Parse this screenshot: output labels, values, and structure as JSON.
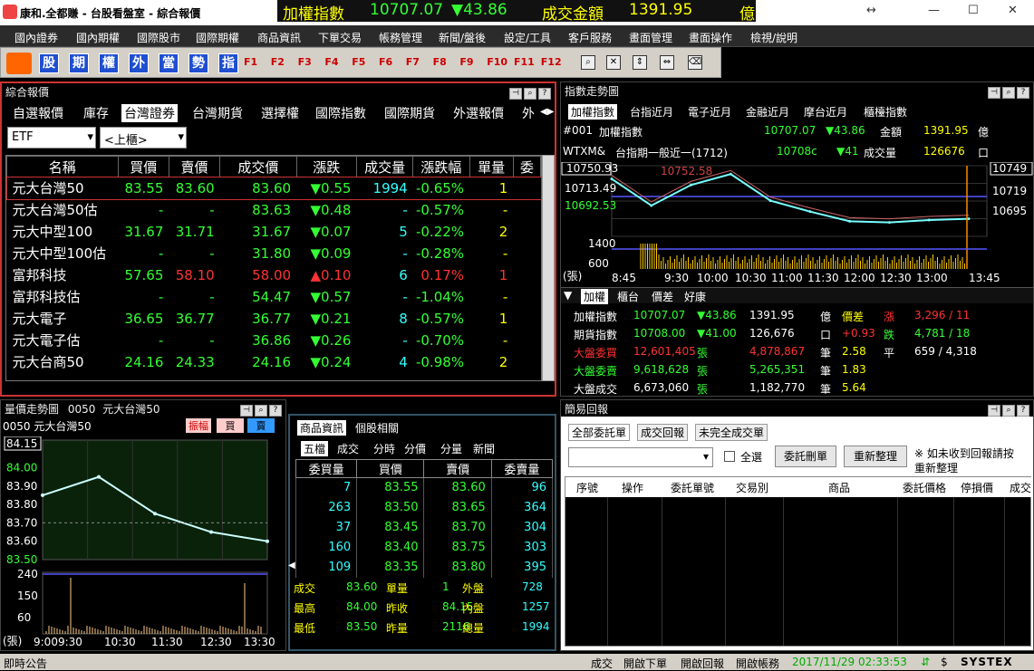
{
  "window": {
    "title": "康和.全都賺 - 台股看盤室 - 綜合報價"
  },
  "ticker": {
    "label": "加權指數",
    "value": "10707.07",
    "change": "▼43.86",
    "amt_label": "成交金額",
    "amt": "1391.95",
    "unit": "億"
  },
  "menu": [
    "國內證券",
    "國內期權",
    "國際股市",
    "國際期權",
    "商品資訊",
    "下單交易",
    "帳務管理",
    "新聞/盤後",
    "設定/工具",
    "客戶服務",
    "畫面管理",
    "畫面操作",
    "檢視/說明"
  ],
  "toolbar": {
    "buttons": [
      "股",
      "期",
      "權",
      "外",
      "當",
      "勢",
      "指"
    ],
    "fkeys": [
      "F1",
      "F2",
      "F3",
      "F4",
      "F5",
      "F6",
      "F7",
      "F8",
      "F9",
      "F10",
      "F11",
      "F12"
    ]
  },
  "quote_panel": {
    "title": "綜合報價",
    "tabs": [
      "自選報價",
      "庫存",
      "台灣證券",
      "台灣期貨",
      "選擇權",
      "國際指數",
      "國際期貨",
      "外選報價",
      "外"
    ],
    "selected_tab": "台灣證券",
    "filter1": "ETF",
    "filter2": "<上櫃>",
    "headers": [
      "名稱",
      "買價",
      "賣價",
      "成交價",
      "漲跌",
      "成交量",
      "漲跌幅",
      "單量",
      "委"
    ],
    "rows": [
      {
        "name": "元大台灣50",
        "bid": "83.55",
        "ask": "83.60",
        "last": "83.60",
        "chg": "▼0.55",
        "vol": "1994",
        "pct": "-0.65%",
        "unit": "1",
        "dir": "down"
      },
      {
        "name": "元大台灣50估",
        "bid": "-",
        "ask": "-",
        "last": "83.63",
        "chg": "▼0.48",
        "vol": "-",
        "pct": "-0.57%",
        "unit": "-",
        "dir": "down"
      },
      {
        "name": "元大中型100",
        "bid": "31.67",
        "ask": "31.71",
        "last": "31.67",
        "chg": "▼0.07",
        "vol": "5",
        "pct": "-0.22%",
        "unit": "2",
        "dir": "down"
      },
      {
        "name": "元大中型100估",
        "bid": "-",
        "ask": "-",
        "last": "31.80",
        "chg": "▼0.09",
        "vol": "-",
        "pct": "-0.28%",
        "unit": "-",
        "dir": "down"
      },
      {
        "name": "富邦科技",
        "bid": "57.65",
        "ask": "58.10",
        "last": "58.00",
        "chg": "▲0.10",
        "vol": "6",
        "pct": "0.17%",
        "unit": "1",
        "dir": "up"
      },
      {
        "name": "富邦科技估",
        "bid": "-",
        "ask": "-",
        "last": "54.47",
        "chg": "▼0.57",
        "vol": "-",
        "pct": "-1.04%",
        "unit": "-",
        "dir": "down"
      },
      {
        "name": "元大電子",
        "bid": "36.65",
        "ask": "36.77",
        "last": "36.77",
        "chg": "▼0.21",
        "vol": "8",
        "pct": "-0.57%",
        "unit": "1",
        "dir": "down"
      },
      {
        "name": "元大電子估",
        "bid": "-",
        "ask": "-",
        "last": "36.86",
        "chg": "▼0.26",
        "vol": "-",
        "pct": "-0.70%",
        "unit": "-",
        "dir": "down"
      },
      {
        "name": "元大台商50",
        "bid": "24.16",
        "ask": "24.33",
        "last": "24.16",
        "chg": "▼0.24",
        "vol": "4",
        "pct": "-0.98%",
        "unit": "2",
        "dir": "down"
      }
    ]
  },
  "index_panel": {
    "title": "指數走勢圖",
    "tabs": [
      "加權指數",
      "台指近月",
      "電子近月",
      "金融近月",
      "摩台近月",
      "櫃檯指數"
    ],
    "line1": {
      "code": "#001",
      "name": "加權指數",
      "value": "10707.07",
      "chg": "▼43.86",
      "amt_label": "金額",
      "amt": "1391.95",
      "unit": "億"
    },
    "line2": {
      "code": "WTXM&",
      "name": "台指期一般近一(1712)",
      "value": "10708c",
      "chg": "▼41",
      "vol_label": "成交量",
      "vol": "126676",
      "unit": "口"
    },
    "y_labels": [
      "10750.93",
      "10713.49",
      "10692.53"
    ],
    "y_right": [
      "10749",
      "10719",
      "10695"
    ],
    "vol_labels": [
      "1400",
      "600"
    ],
    "vol_unit": "(張)",
    "annot": "10752.58",
    "x_labels": [
      "8:45",
      "9:30",
      "10:00",
      "10:30",
      "11:00",
      "11:30",
      "12:00",
      "12:30",
      "13:00",
      "13:45"
    ],
    "subtabs": [
      "加權",
      "櫃台",
      "價差",
      "好康"
    ],
    "stats": [
      [
        "加權指數",
        "10707.07",
        "▼43.86",
        "1391.95",
        "億",
        "價差",
        "漲",
        "3,296 / 11"
      ],
      [
        "期貨指數",
        "10708.00",
        "▼41.00",
        "126,676",
        "口",
        "+0.93",
        "跌",
        "4,781 / 18"
      ],
      [
        "大盤委買",
        "12,601,405",
        "張",
        "4,878,867",
        "筆",
        "2.58",
        "平",
        "659 / 4,318"
      ],
      [
        "大盤委賣",
        "9,618,628",
        "張",
        "5,265,351",
        "筆",
        "1.83",
        "",
        ""
      ],
      [
        "大盤成交",
        "6,673,060",
        "張",
        "1,182,770",
        "筆",
        "5.64",
        "",
        ""
      ]
    ]
  },
  "price_panel": {
    "title": "量價走勢圖",
    "code": "0050",
    "name": "元大台灣50",
    "sub": "0050 元大台灣50",
    "btns": [
      "振幅",
      "買",
      "賣"
    ],
    "y_labels": [
      "84.15",
      "84.00",
      "83.90",
      "83.80",
      "83.70",
      "83.60",
      "83.50"
    ],
    "vol_labels": [
      "240",
      "150",
      "60"
    ],
    "vol_unit": "(張)",
    "x_labels": [
      "9:009:30",
      "10:30",
      "11:30",
      "12:30",
      "13:30"
    ]
  },
  "book_panel": {
    "tabs": [
      "商品資訊",
      "個股相關"
    ],
    "subtabs": [
      "五檔",
      "成交",
      "分時",
      "分價",
      "分量",
      "新聞"
    ],
    "headers": [
      "委買量",
      "買價",
      "賣價",
      "委賣量"
    ],
    "rows": [
      [
        "7",
        "83.55",
        "83.60",
        "96"
      ],
      [
        "263",
        "83.50",
        "83.65",
        "364"
      ],
      [
        "37",
        "83.45",
        "83.70",
        "304"
      ],
      [
        "160",
        "83.40",
        "83.75",
        "303"
      ],
      [
        "109",
        "83.35",
        "83.80",
        "395"
      ]
    ],
    "summary": [
      [
        "成交",
        "83.60",
        "單量",
        "1",
        "外盤",
        "728"
      ],
      [
        "最高",
        "84.00",
        "昨收",
        "84.15",
        "內盤",
        "1257"
      ],
      [
        "最低",
        "83.50",
        "昨量",
        "2116",
        "總量",
        "1994"
      ]
    ]
  },
  "order_panel": {
    "title": "簡易回報",
    "tabs": [
      "全部委託單",
      "成交回報",
      "未完全成交單"
    ],
    "checkbox": "全選",
    "btn1": "委託刪單",
    "btn2": "重新整理",
    "note1": "※ 如未收到回報請按",
    "note2": "重新整理",
    "headers": [
      "序號",
      "操作",
      "委託單號",
      "交易別",
      "商品",
      "委託價格",
      "停損價",
      "成交"
    ]
  },
  "status": {
    "left": "即時公告",
    "items": [
      "成交",
      "開啟下單",
      "開啟回報",
      "開啟帳務"
    ],
    "time": "2017/11/29 02:33:53",
    "brand": "SYSTEX"
  },
  "chart_data": [
    {
      "type": "line",
      "title": "加權指數",
      "x": [
        "8:45",
        "9:30",
        "10:00",
        "10:30",
        "11:00",
        "11:30",
        "12:00",
        "12:30",
        "13:00",
        "13:45"
      ],
      "series": [
        {
          "name": "加權指數",
          "values": [
            10740,
            10718,
            10735,
            10744,
            10722,
            10713,
            10705,
            10704,
            10706,
            10707
          ]
        }
      ],
      "ylim": [
        10692.53,
        10750.93
      ]
    },
    {
      "type": "line",
      "title": "0050",
      "x": [
        "9:00",
        "10:30",
        "11:30",
        "12:30",
        "13:30"
      ],
      "series": [
        {
          "name": "元大台灣50",
          "values": [
            83.85,
            83.95,
            83.75,
            83.65,
            83.6
          ]
        }
      ],
      "ylim": [
        83.5,
        84.15
      ]
    }
  ]
}
